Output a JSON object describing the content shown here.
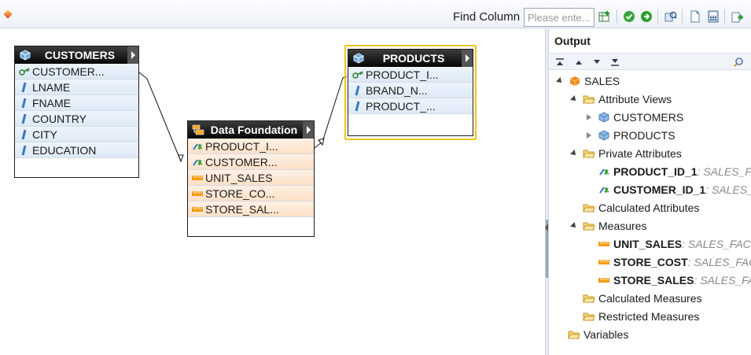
{
  "toolbar": {
    "find_label": "Find Column",
    "find_placeholder": "Please ente..."
  },
  "nodes": {
    "customers": {
      "title": "CUSTOMERS",
      "rows": [
        "CUSTOMER...",
        "LNAME",
        "FNAME",
        "COUNTRY",
        "CITY",
        "EDUCATION"
      ]
    },
    "data_foundation": {
      "title": "Data Foundation",
      "rows": [
        "PRODUCT_I...",
        "CUSTOMER...",
        "UNIT_SALES",
        "STORE_CO...",
        "STORE_SAL..."
      ]
    },
    "products": {
      "title": "PRODUCTS",
      "rows": [
        "PRODUCT_I...",
        "BRAND_N...",
        "PRODUCT_..."
      ]
    }
  },
  "output": {
    "title": "Output",
    "tree": {
      "root": "SALES",
      "attribute_views": "Attribute Views",
      "attr_customers": "CUSTOMERS",
      "attr_products": "PRODUCTS",
      "private_attributes": "Private Attributes",
      "pa_product_name": "PRODUCT_ID_1",
      "pa_product_type": " : SALES_FA",
      "pa_customer_name": "CUSTOMER_ID_1",
      "pa_customer_type": " : SALES_F",
      "calculated_attributes": "Calculated Attributes",
      "measures": "Measures",
      "m_unit_name": "UNIT_SALES",
      "m_unit_type": " : SALES_FACT_",
      "m_cost_name": "STORE_COST",
      "m_cost_type": " : SALES_FACT",
      "m_sales_name": "STORE_SALES",
      "m_sales_type": " : SALES_FAC",
      "calculated_measures": "Calculated Measures",
      "restricted_measures": "Restricted Measures",
      "variables": "Variables"
    }
  },
  "colors": {
    "selection": "#f0c419",
    "header_black": "#050505",
    "blue_row": "#dde9f6",
    "orange_row": "#fde0c8"
  },
  "icons": [
    "cube-icon",
    "key-icon",
    "attribute-icon",
    "measure-icon",
    "folder-icon",
    "data-foundation-icon"
  ]
}
